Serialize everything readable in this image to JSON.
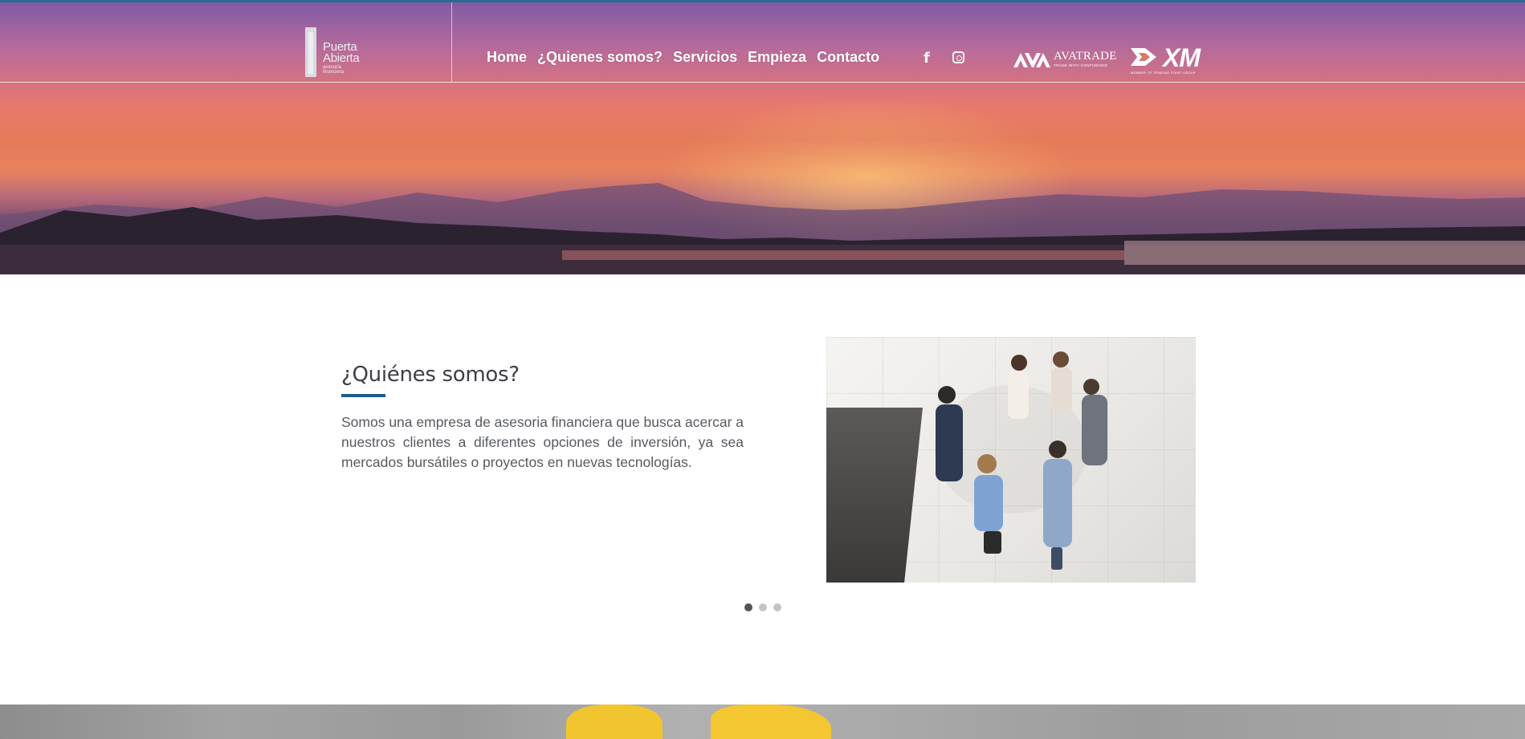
{
  "brand": {
    "logo_line1": "Puerta",
    "logo_line2": "Abierta",
    "logo_sub1": "asesoría",
    "logo_sub2": "financiera"
  },
  "nav": {
    "items": [
      {
        "label": "Home"
      },
      {
        "label": "¿Quienes somos?"
      },
      {
        "label": "Servicios"
      },
      {
        "label": "Empieza"
      },
      {
        "label": "Contacto"
      }
    ]
  },
  "social": {
    "facebook_glyph": "f",
    "facebook_icon": "facebook-icon",
    "instagram_icon": "instagram-icon"
  },
  "partners": {
    "avatrade_name": "AVATRADE",
    "avatrade_tag": "TRADE WITH CONFIDENCE",
    "xm_name": "XM",
    "xm_tag": "MEMBER OF TRADING POINT GROUP"
  },
  "about": {
    "title": "¿Quiénes somos?",
    "body": "Somos una empresa de asesoria financiera que busca acercar a nuestros clientes a diferentes opciones de inversión, ya sea mercados bursátiles o proyectos en nuevas tecnologías."
  },
  "carousel": {
    "slides": 3,
    "active_index": 0
  },
  "colors": {
    "accent": "#1e5e84",
    "heading": "#3d3f45",
    "text": "#555a60"
  }
}
